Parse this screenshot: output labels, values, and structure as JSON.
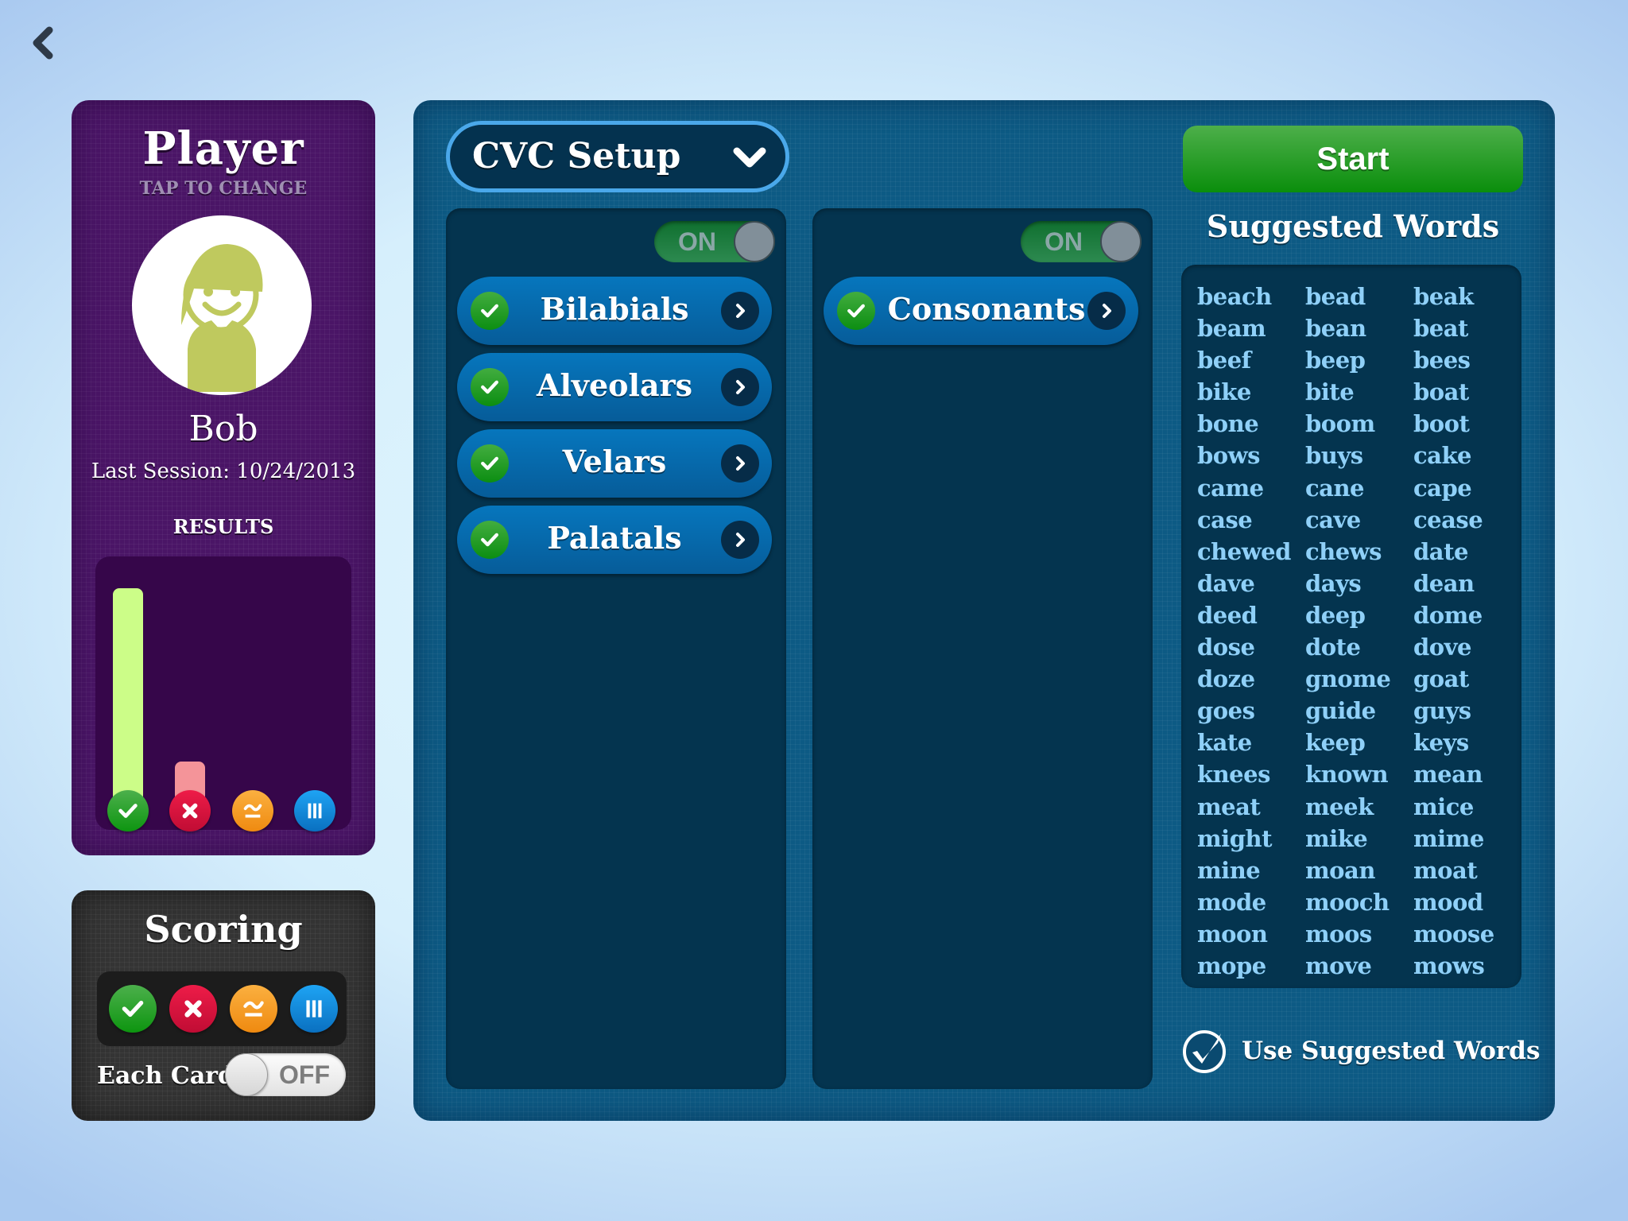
{
  "nav": {
    "back_icon": "chevron-left-icon"
  },
  "player": {
    "title": "Player",
    "subtitle": "TAP TO CHANGE",
    "name": "Bob",
    "last_session": "Last Session: 10/24/2013",
    "results_label": "RESULTS",
    "results": [
      {
        "type": "correct",
        "icon": "check-icon",
        "color": "#ccfd88",
        "fraction": 1.0
      },
      {
        "type": "incorrect",
        "icon": "x-icon",
        "color": "#f49499",
        "fraction": 0.22
      },
      {
        "type": "approximate",
        "icon": "approx-icon",
        "color": "#fbb040",
        "fraction": 0
      },
      {
        "type": "prompted",
        "icon": "tally-icon",
        "color": "#1ea4f4",
        "fraction": 0
      }
    ]
  },
  "scoring": {
    "title": "Scoring",
    "buttons": [
      {
        "name": "correct",
        "icon": "check-icon"
      },
      {
        "name": "incorrect",
        "icon": "x-icon"
      },
      {
        "name": "approximate",
        "icon": "approx-icon"
      },
      {
        "name": "prompted",
        "icon": "tally-icon"
      }
    ],
    "each_card_label": "Each Card",
    "each_card_state": "OFF"
  },
  "setup": {
    "dropdown_label": "CVC Setup",
    "left_column": {
      "toggle": "ON",
      "items": [
        {
          "label": "Bilabials",
          "checked": true
        },
        {
          "label": "Alveolars",
          "checked": true
        },
        {
          "label": "Velars",
          "checked": true
        },
        {
          "label": "Palatals",
          "checked": true
        }
      ]
    },
    "middle_column": {
      "toggle": "ON",
      "items": [
        {
          "label": "Consonants",
          "checked": true
        }
      ]
    }
  },
  "start_label": "Start",
  "suggested": {
    "title": "Suggested Words",
    "words": [
      "beach",
      "bead",
      "beak",
      "beam",
      "bean",
      "beat",
      "beef",
      "beep",
      "bees",
      "bike",
      "bite",
      "boat",
      "bone",
      "boom",
      "boot",
      "bows",
      "buys",
      "cake",
      "came",
      "cane",
      "cape",
      "case",
      "cave",
      "cease",
      "chewed",
      "chews",
      "date",
      "dave",
      "days",
      "dean",
      "deed",
      "deep",
      "dome",
      "dose",
      "dote",
      "dove",
      "doze",
      "gnome",
      "goat",
      "goes",
      "guide",
      "guys",
      "kate",
      "keep",
      "keys",
      "knees",
      "known",
      "mean",
      "meat",
      "meek",
      "mice",
      "might",
      "mike",
      "mime",
      "mine",
      "moan",
      "moat",
      "mode",
      "mooch",
      "mood",
      "moon",
      "moos",
      "moose",
      "mope",
      "move",
      "mows"
    ],
    "use_label": "Use Suggested Words",
    "use_checked": true
  }
}
